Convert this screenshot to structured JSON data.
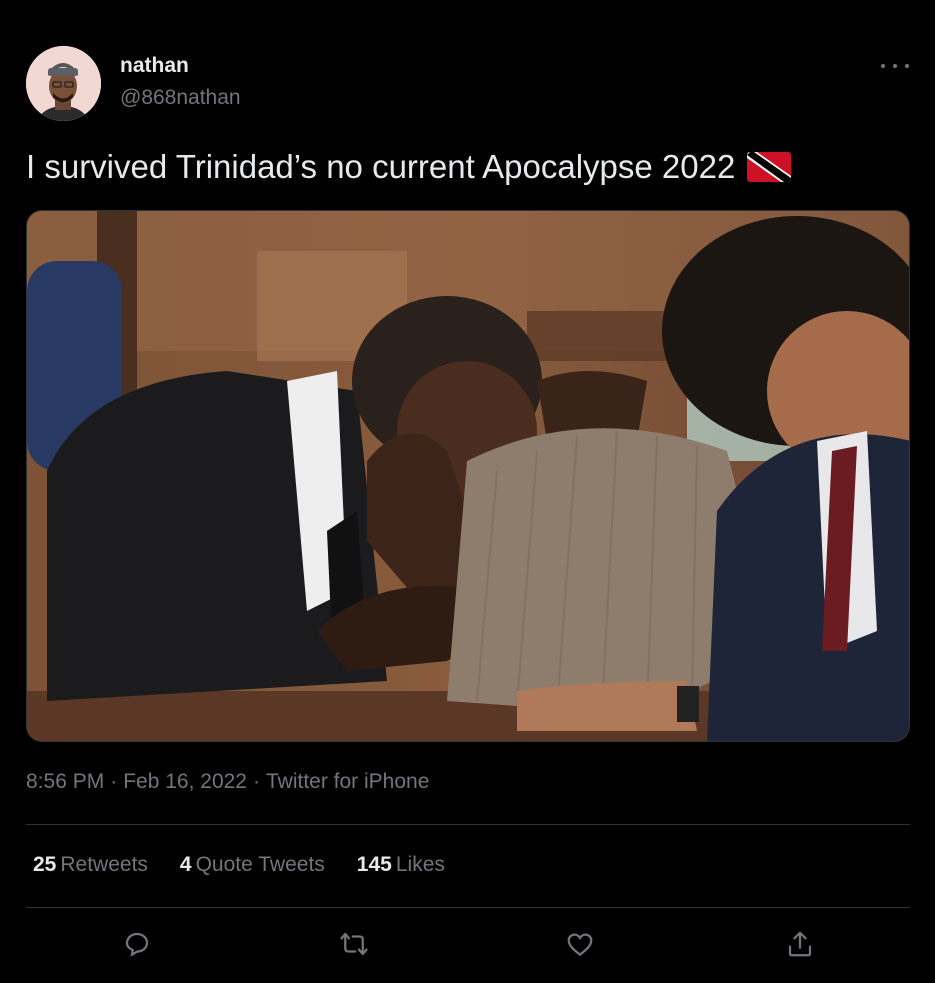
{
  "author": {
    "name": "nathan",
    "handle": "@868nathan",
    "avatar_icon": "profile-photo"
  },
  "tweet": {
    "text": "I survived Trinidad’s no current Apocalypse 2022",
    "emoji": "flag-trinidad-and-tobago",
    "time": "8:56 PM",
    "date": "Feb 16, 2022",
    "source": "Twitter for iPhone",
    "separator": "·"
  },
  "stats": {
    "retweets": {
      "count": "25",
      "label": "Retweets"
    },
    "quote_tweets": {
      "count": "4",
      "label": "Quote Tweets"
    },
    "likes": {
      "count": "145",
      "label": "Likes"
    }
  },
  "actions": [
    "reply-icon",
    "retweet-icon",
    "like-icon",
    "share-icon"
  ],
  "colors": {
    "background": "#000000",
    "text": "#e7e9ea",
    "secondary": "#71767b",
    "border": "#2f3336"
  }
}
